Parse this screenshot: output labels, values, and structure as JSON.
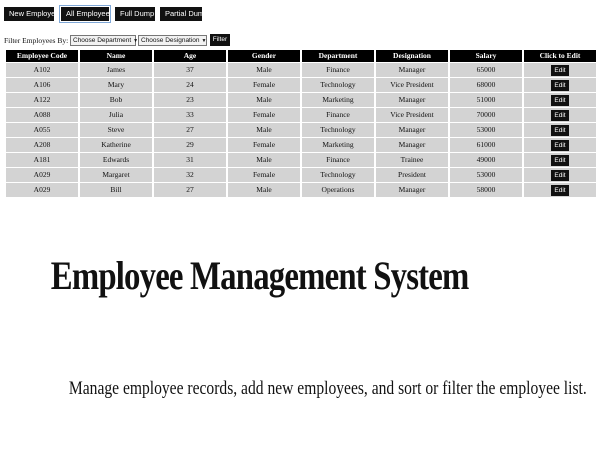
{
  "toolbar": {
    "new_employee": "New Employee",
    "all_employees": "All Employees",
    "full_dump": "Full Dump",
    "partial_dump": "Partial Dump"
  },
  "filter": {
    "label": "Filter Employees By:",
    "department_select": "Choose Department",
    "designation_select": "Choose Designation",
    "button": "Filter"
  },
  "table": {
    "headers": [
      "Employee Code",
      "Name",
      "Age",
      "Gender",
      "Department",
      "Designation",
      "Salary",
      "Click to Edit"
    ],
    "edit_label": "Edit",
    "rows": [
      [
        "A102",
        "James",
        "37",
        "Male",
        "Finance",
        "Manager",
        "65000"
      ],
      [
        "A106",
        "Mary",
        "24",
        "Female",
        "Technology",
        "Vice President",
        "68000"
      ],
      [
        "A122",
        "Bob",
        "23",
        "Male",
        "Marketing",
        "Manager",
        "51000"
      ],
      [
        "A088",
        "Julia",
        "33",
        "Female",
        "Finance",
        "Vice President",
        "70000"
      ],
      [
        "A055",
        "Steve",
        "27",
        "Male",
        "Technology",
        "Manager",
        "53000"
      ],
      [
        "A208",
        "Katherine",
        "29",
        "Female",
        "Marketing",
        "Manager",
        "61000"
      ],
      [
        "A181",
        "Edwards",
        "31",
        "Male",
        "Finance",
        "Trainee",
        "49000"
      ],
      [
        "A029",
        "Margaret",
        "32",
        "Female",
        "Technology",
        "President",
        "53000"
      ],
      [
        "A029",
        "Bill",
        "27",
        "Male",
        "Operations",
        "Manager",
        "58000"
      ]
    ]
  },
  "hero": {
    "title": "Employee Management System",
    "subtitle": "Manage employee records, add new employees, and sort or filter the employee list."
  },
  "colors": {
    "button_bg": "#111111",
    "header_bg": "#000000",
    "row_bg": "#d3d3d3"
  },
  "icons": {
    "dropdown_caret": "caret-down-icon"
  }
}
